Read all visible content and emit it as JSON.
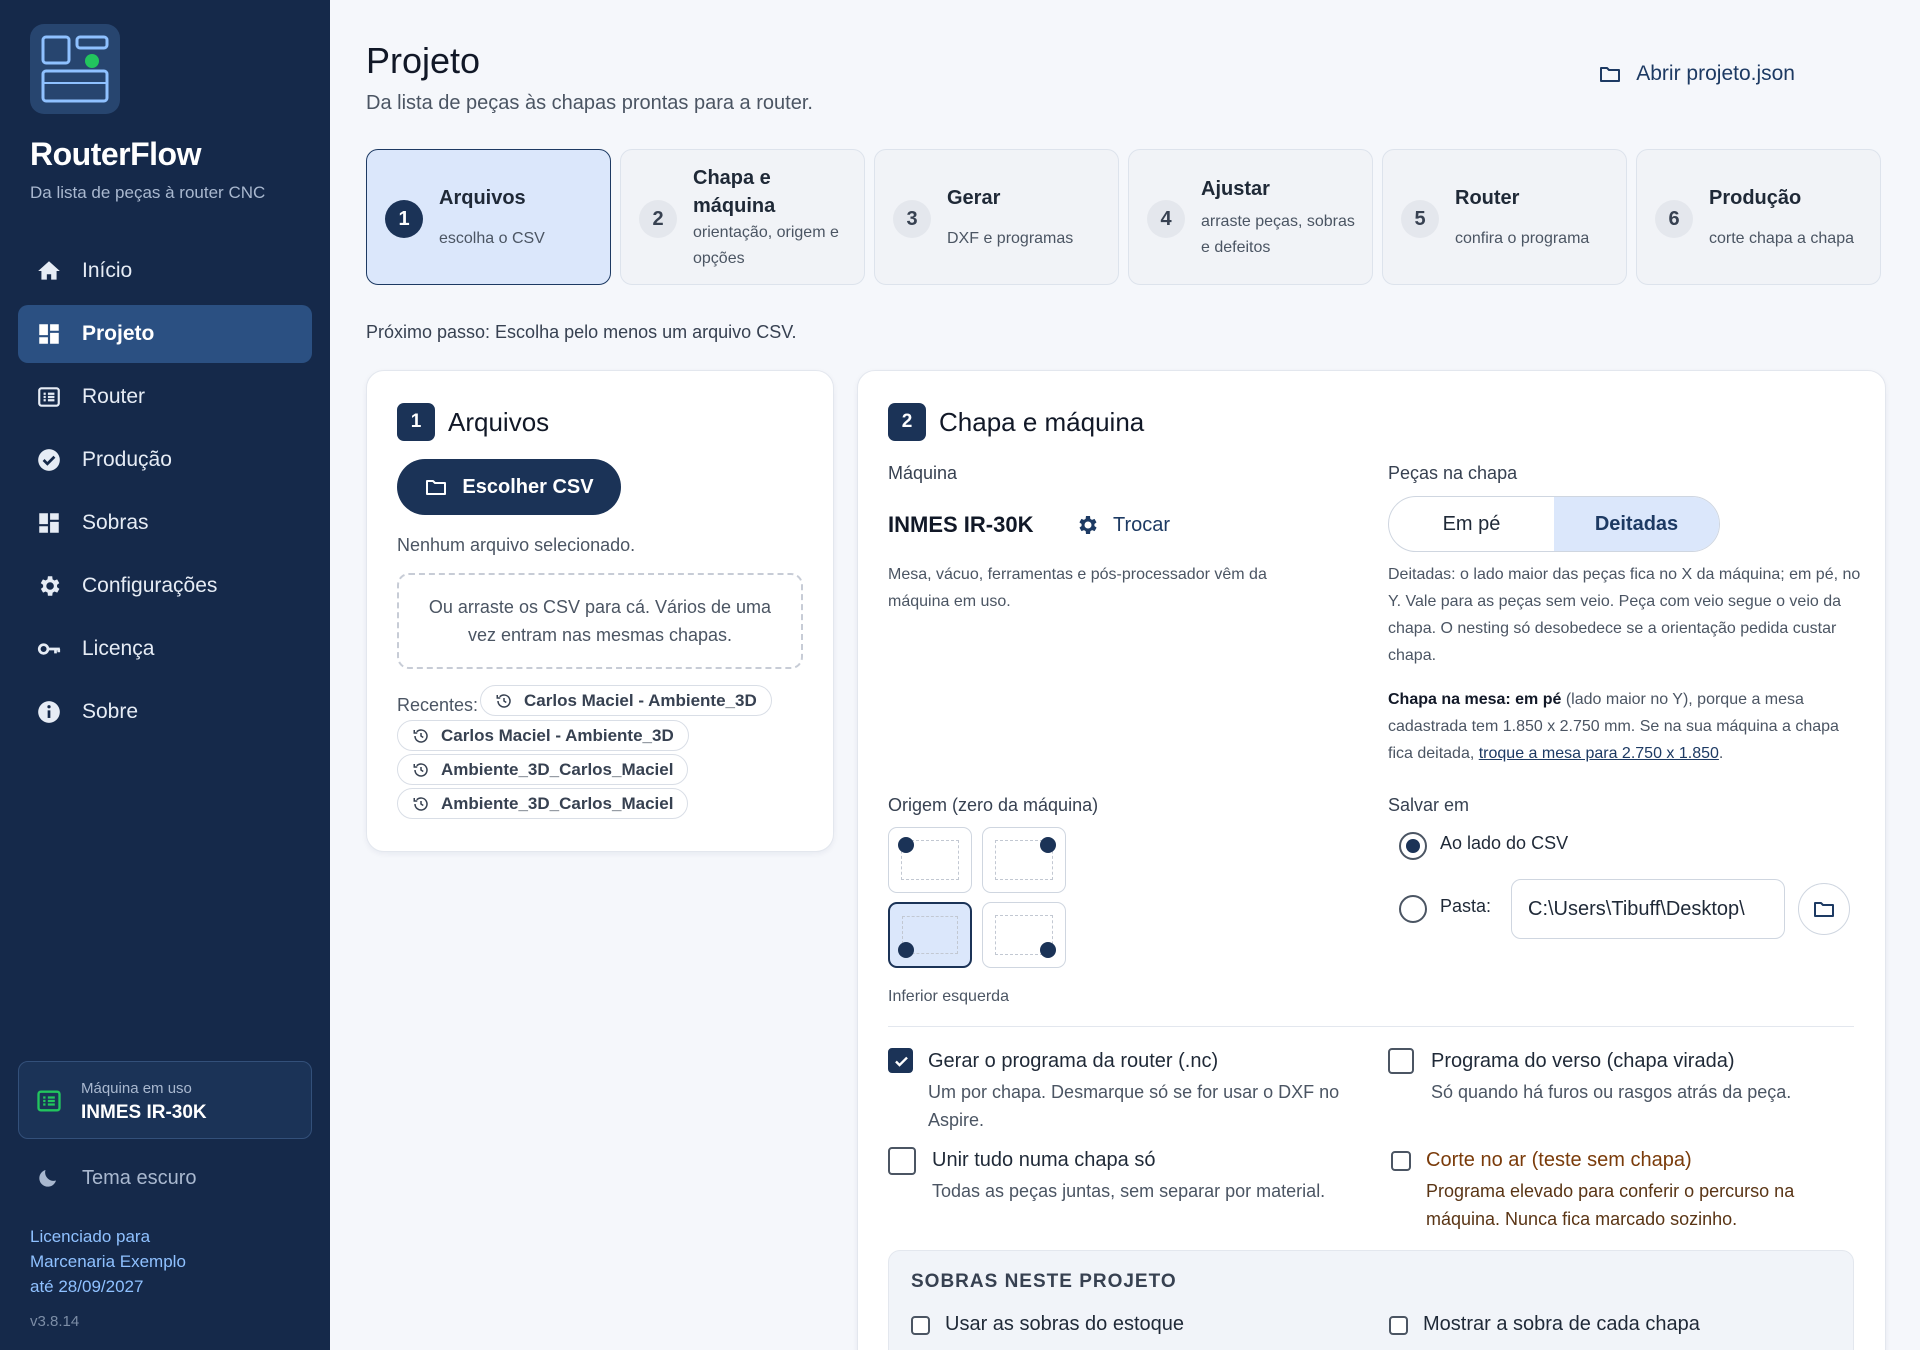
{
  "sidebar": {
    "brand": "RouterFlow",
    "brand_sub": "Da lista de peças à router CNC",
    "items": [
      {
        "label": "Início",
        "icon": "home-icon"
      },
      {
        "label": "Projeto",
        "icon": "dashboard-icon",
        "active": true
      },
      {
        "label": "Router",
        "icon": "router-icon"
      },
      {
        "label": "Produção",
        "icon": "check-circle-icon"
      },
      {
        "label": "Sobras",
        "icon": "grid-icon"
      },
      {
        "label": "Configurações",
        "icon": "gear-icon"
      },
      {
        "label": "Licença",
        "icon": "key-icon"
      },
      {
        "label": "Sobre",
        "icon": "info-icon"
      }
    ],
    "machine_label": "Máquina em uso",
    "machine_name": "INMES IR-30K",
    "theme_label": "Tema escuro",
    "license_line1": "Licenciado para",
    "license_line2": "Marcenaria Exemplo",
    "license_line3": "até 28/09/2027",
    "version": "v3.8.14"
  },
  "header": {
    "title": "Projeto",
    "subtitle": "Da lista de peças às chapas prontas para a router.",
    "open_label": "Abrir projeto.json"
  },
  "steps": [
    {
      "num": "1",
      "title": "Arquivos",
      "desc": "escolha o CSV"
    },
    {
      "num": "2",
      "title": "Chapa e máquina",
      "desc": "orientação, origem e opções"
    },
    {
      "num": "3",
      "title": "Gerar",
      "desc": "DXF e programas"
    },
    {
      "num": "4",
      "title": "Ajustar",
      "desc": "arraste peças, sobras e defeitos"
    },
    {
      "num": "5",
      "title": "Router",
      "desc": "confira o programa"
    },
    {
      "num": "6",
      "title": "Produção",
      "desc": "corte chapa a chapa"
    }
  ],
  "next_step": "Próximo passo: Escolha pelo menos um arquivo CSV.",
  "files": {
    "num": "1",
    "title": "Arquivos",
    "choose_label": "Escolher CSV",
    "no_file": "Nenhum arquivo selecionado.",
    "dropzone": "Ou arraste os CSV para cá. Vários de uma vez entram nas mesmas chapas.",
    "recent_label": "Recentes:",
    "recent": [
      "Carlos Maciel - Ambiente_3D",
      "Carlos Maciel - Ambiente_3D",
      "Ambiente_3D_Carlos_Maciel",
      "Ambiente_3D_Carlos_Maciel"
    ]
  },
  "sheet": {
    "num": "2",
    "title": "Chapa e máquina",
    "machine_label": "Máquina",
    "machine_name": "INMES IR-30K",
    "change_label": "Trocar",
    "machine_note": "Mesa, vácuo, ferramentas e pós-processador vêm da máquina em uso.",
    "pieces_label": "Peças na chapa",
    "orient_standing": "Em pé",
    "orient_lying": "Deitadas",
    "orient_selected": "Deitadas",
    "orient_note": "Deitadas: o lado maior das peças fica no X da máquina; em pé, no Y. Vale para as peças sem veio. Peça com veio segue o veio da chapa. O nesting só desobedece se a orientação pedida custar chapa.",
    "table_bold": "Chapa na mesa: em pé",
    "table_text": " (lado maior no Y), porque a mesa cadastrada tem 1.850 x 2.750 mm. Se na sua máquina a chapa fica deitada, ",
    "table_link": "troque a mesa para 2.750 x 1.850",
    "table_end": ".",
    "origin_label": "Origem (zero da máquina)",
    "origin_selected": "Inferior esquerda",
    "save_label": "Salvar em",
    "save_beside": "Ao lado do CSV",
    "save_folder": "Pasta:",
    "folder_path": "C:\\Users\\Tibuff\\Desktop\\",
    "opt_nc_title": "Gerar o programa da router (.nc)",
    "opt_nc_desc": "Um por chapa. Desmarque só se for usar o DXF no Aspire.",
    "opt_verso_title": "Programa do verso (chapa virada)",
    "opt_verso_desc": "Só quando há furos ou rasgos atrás da peça.",
    "opt_unir_title": "Unir tudo numa chapa só",
    "opt_unir_desc": "Todas as peças juntas, sem separar por material.",
    "opt_ar_title": "Corte no ar (teste sem chapa)",
    "opt_ar_desc": "Programa elevado para conferir o percurso na máquina. Nunca fica marcado sozinho.",
    "sobras_title": "SOBRAS NESTE PROJETO",
    "sobras_use": "Usar as sobras do estoque",
    "sobras_show": "Mostrar a sobra de cada chapa"
  },
  "colors": {
    "sidebar": "#15294a",
    "accent": "#1b3357",
    "active_fill": "#dbe7fb"
  }
}
